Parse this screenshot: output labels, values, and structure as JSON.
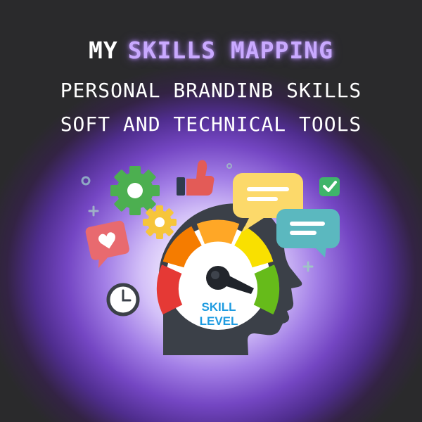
{
  "title": {
    "prefix": "MY",
    "highlight": "SKILLS MAPPING",
    "line2": "PERSONAL BRANDINB SKILLS",
    "line3": "SOFT AND TECHNICAL TOOLS"
  },
  "gauge": {
    "label_line1": "SKILL",
    "label_line2": "LEVEL"
  },
  "icons": {
    "large_gear": "gear-icon",
    "small_gear": "gear-icon",
    "thumbs_up": "thumbs-up-icon",
    "heart": "heart-icon",
    "clock": "clock-icon",
    "check": "check-icon",
    "yellow_bubble": "chat-bubble-icon",
    "teal_bubble": "chat-bubble-icon"
  },
  "colors": {
    "accent_title": "#c9a9ff",
    "head": "#3b4048",
    "gear_green": "#4caf50",
    "gear_yellow": "#f6c53b",
    "gauge_label": "#1e9be0"
  }
}
